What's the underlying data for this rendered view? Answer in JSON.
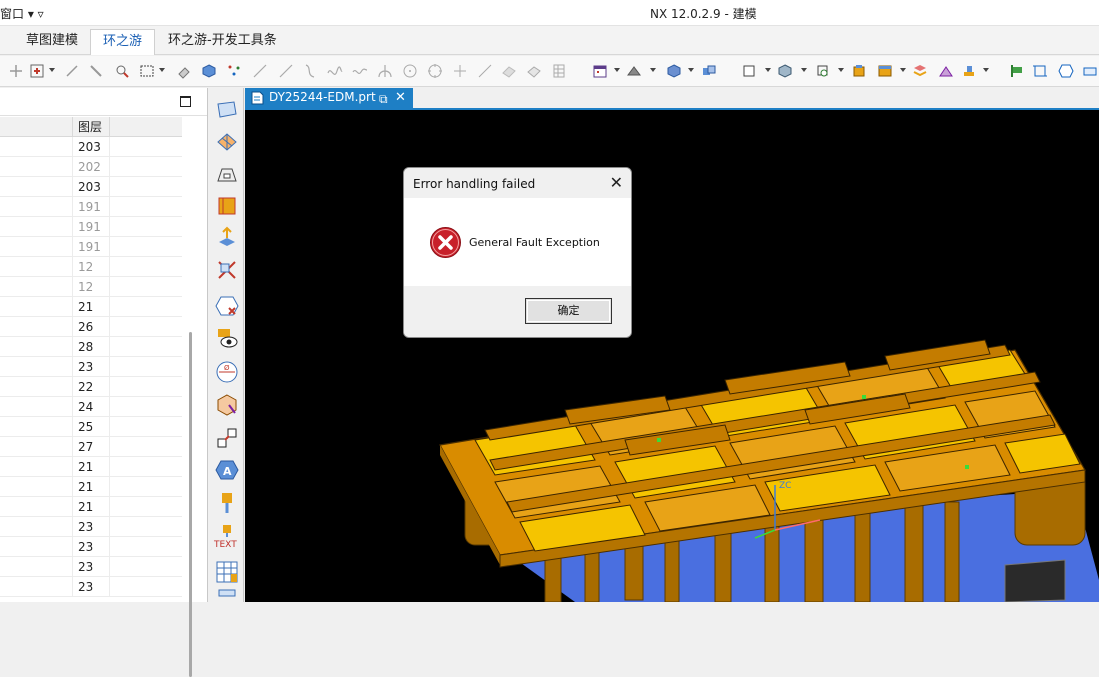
{
  "window": {
    "menu_left": "窗口 ▾ ▿",
    "title": "NX 12.0.2.9 - 建模"
  },
  "ribbon_tabs": [
    {
      "label": "草图建模",
      "active": false
    },
    {
      "label": "环之游",
      "active": true
    },
    {
      "label": "环之游-开发工具条",
      "active": false
    }
  ],
  "left_panel": {
    "column_header": "图层",
    "rows": [
      {
        "value": "203",
        "dim": false
      },
      {
        "value": "202",
        "dim": true
      },
      {
        "value": "203",
        "dim": false
      },
      {
        "value": "191",
        "dim": true
      },
      {
        "value": "191",
        "dim": true
      },
      {
        "value": "191",
        "dim": true
      },
      {
        "value": "12",
        "dim": true
      },
      {
        "value": "12",
        "dim": true
      },
      {
        "value": "21",
        "dim": false
      },
      {
        "value": "26",
        "dim": false
      },
      {
        "value": "28",
        "dim": false
      },
      {
        "value": "23",
        "dim": false
      },
      {
        "value": "22",
        "dim": false
      },
      {
        "value": "24",
        "dim": false
      },
      {
        "value": "25",
        "dim": false
      },
      {
        "value": "27",
        "dim": false
      },
      {
        "value": "21",
        "dim": false
      },
      {
        "value": "21",
        "dim": false
      },
      {
        "value": "21",
        "dim": false
      },
      {
        "value": "23",
        "dim": false
      },
      {
        "value": "23",
        "dim": false
      },
      {
        "value": "23",
        "dim": false
      },
      {
        "value": "23",
        "dim": false
      }
    ]
  },
  "icon_strip": {
    "text_icon_label": "TEXT"
  },
  "document_tab": {
    "label": "DY25244-EDM.prt",
    "popout": "⧉",
    "close": "✕"
  },
  "dialog": {
    "title": "Error handling failed",
    "close": "✕",
    "message": "General Fault Exception",
    "ok_label": "确定"
  },
  "colors": {
    "accent": "#1e7fc5",
    "model_orange": "#e8a317",
    "model_yellow": "#f5c400",
    "error_red": "#c8202a"
  }
}
